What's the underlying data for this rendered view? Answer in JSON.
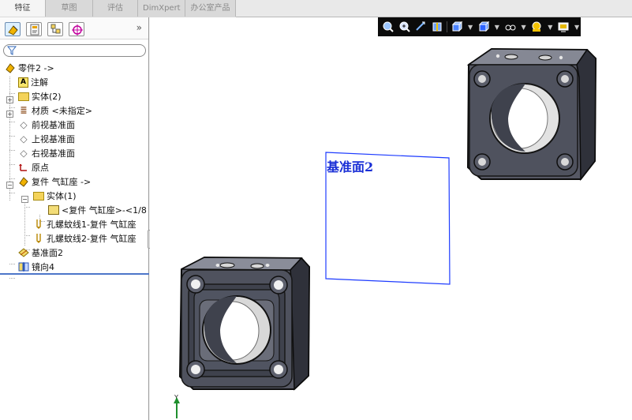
{
  "tabs": [
    {
      "label": "特征",
      "active": true
    },
    {
      "label": "草图",
      "active": false
    },
    {
      "label": "评估",
      "active": false
    },
    {
      "label": "DimXpert",
      "active": false
    },
    {
      "label": "办公室产品",
      "active": false
    }
  ],
  "panel": {
    "more_label": "»",
    "filter_icon": "filter-icon"
  },
  "tree": {
    "root": "零件2 ->",
    "items": [
      {
        "label": "注解"
      },
      {
        "label": "实体(2)"
      },
      {
        "label": "材质 <未指定>"
      },
      {
        "label": "前视基准面"
      },
      {
        "label": "上视基准面"
      },
      {
        "label": "右视基准面"
      },
      {
        "label": "原点"
      },
      {
        "label": "复件 气缸座 ->"
      },
      {
        "label": "实体(1)"
      },
      {
        "label": "<复件 气缸座>-<1/8"
      },
      {
        "label": "孔螺蚊线1-复件 气缸座"
      },
      {
        "label": "孔螺蚊线2-复件 气缸座"
      },
      {
        "label": "基准面2"
      },
      {
        "label": "镜向4"
      }
    ]
  },
  "viewport": {
    "plane_label": "基准面2",
    "axis_label": "Y"
  },
  "colors": {
    "accent": "#1a2fd6",
    "tree_line": "#4d76c9",
    "hud_bg": "#0b0b0b",
    "part": "#4a4c57"
  }
}
